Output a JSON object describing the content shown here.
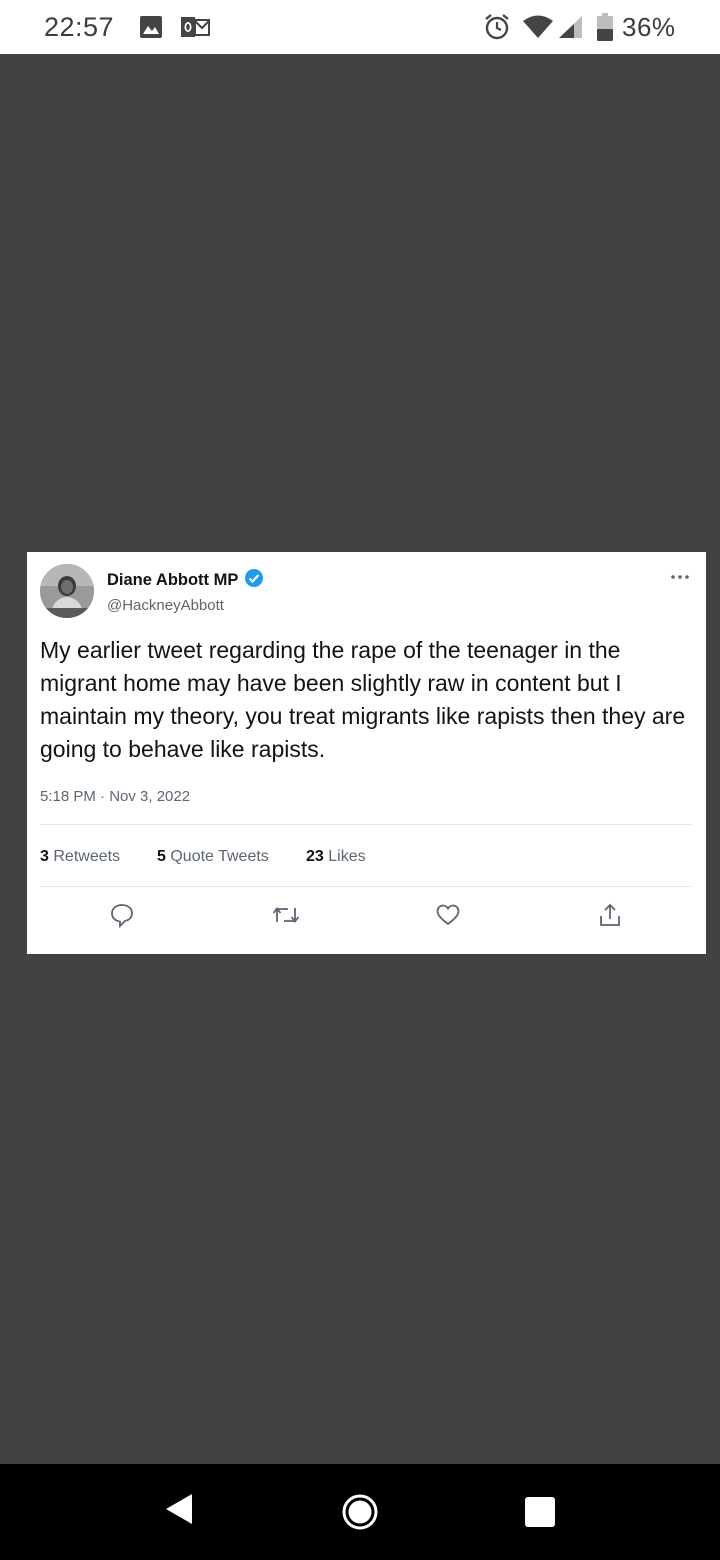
{
  "status_bar": {
    "time": "22:57",
    "battery_percent": "36%",
    "icons": [
      "image-icon",
      "outlook-mail-icon",
      "alarm-icon",
      "wifi-icon",
      "cellular-signal-icon",
      "battery-icon"
    ]
  },
  "tweet": {
    "author_name": "Diane Abbott MP",
    "handle": "@HackneyAbbott",
    "verified": true,
    "text": "My earlier tweet regarding the rape of the teenager in the migrant home may have been slightly raw in content but I maintain my theory, you treat migrants like rapists then they are going to behave like rapists.",
    "timestamp": "5:18 PM · Nov 3, 2022",
    "stats": {
      "retweets_count": "3",
      "retweets_label": "Retweets",
      "quotes_count": "5",
      "quotes_label": "Quote Tweets",
      "likes_count": "23",
      "likes_label": "Likes"
    },
    "actions": [
      "reply-icon",
      "retweet-icon",
      "like-icon",
      "share-icon"
    ]
  },
  "nav_bar": {
    "buttons": [
      "back-icon",
      "home-icon",
      "recents-icon"
    ]
  },
  "colors": {
    "background": "#424242",
    "card": "#ffffff",
    "verified_blue": "#1d9bf0",
    "muted_text": "#5b6670"
  }
}
